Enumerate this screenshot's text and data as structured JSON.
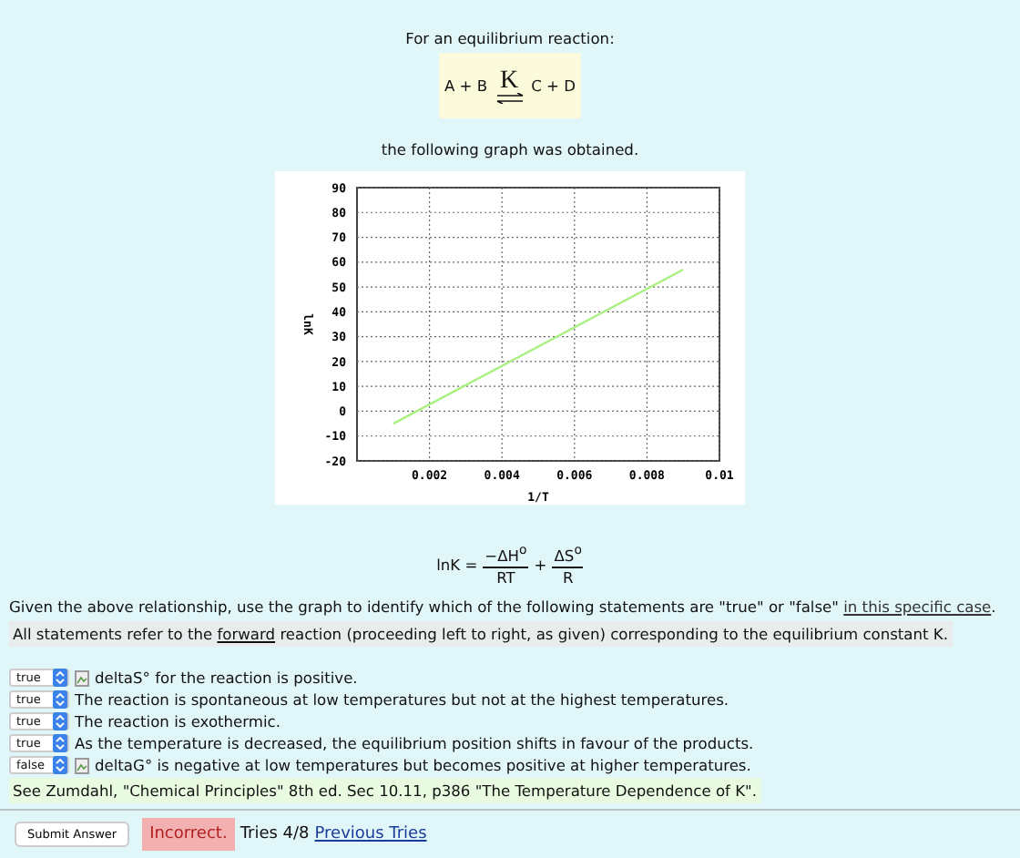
{
  "intro": "For an equilibrium reaction:",
  "reaction": {
    "left": "A + B",
    "constant": "K",
    "right": "C + D"
  },
  "graph_caption": "the following graph was obtained.",
  "chart_data": {
    "type": "line",
    "xlabel": "1/T",
    "ylabel": "lnK",
    "x": [
      0.001,
      0.009
    ],
    "series": [
      {
        "color": "#a8f080",
        "values": [
          -5,
          57
        ]
      }
    ],
    "grid": true,
    "xlim": [
      0,
      0.01
    ],
    "ylim": [
      -20,
      90
    ],
    "xticks": [
      {
        "value": 0.002,
        "label": "0.002"
      },
      {
        "value": 0.004,
        "label": "0.004"
      },
      {
        "value": 0.006,
        "label": "0.006"
      },
      {
        "value": 0.008,
        "label": "0.008"
      },
      {
        "value": 0.01,
        "label": "0.01"
      }
    ],
    "yticks": [
      -20,
      -10,
      0,
      10,
      20,
      30,
      40,
      50,
      60,
      70,
      80,
      90
    ]
  },
  "equation": {
    "lhs": "lnK =",
    "term1_num": "−ΔH$^{o}$",
    "term1_den": "RT",
    "operator": "+",
    "term2_num": "ΔS$^{o}$",
    "term2_den": "R"
  },
  "instruction": {
    "text": "Given the above relationship, use the graph to identify which of the following statements are \"true\" or \"false\"",
    "link": "in this specific case",
    "end": "."
  },
  "note": {
    "before": "All statements refer to the",
    "underlined": "forward",
    "after": "reaction (proceeding left to right, as given) corresponding to the equilibrium constant K."
  },
  "statements": [
    {
      "answer": "true",
      "has_image": true,
      "text": "deltaS° for the reaction is positive."
    },
    {
      "answer": "true",
      "has_image": false,
      "text": "The reaction is spontaneous at low temperatures but not at the highest temperatures."
    },
    {
      "answer": "true",
      "has_image": false,
      "text": "The reaction is exothermic."
    },
    {
      "answer": "true",
      "has_image": false,
      "text": "As the temperature is decreased, the equilibrium position shifts in favour of the products."
    },
    {
      "answer": "false",
      "has_image": true,
      "text": "deltaG° is negative at low temperatures but becomes positive at higher temperatures."
    }
  ],
  "reference": "See Zumdahl, \"Chemical Principles\" 8th ed. Sec 10.11, p386 \"The Temperature Dependence of K\".",
  "submit_button": "Submit Answer",
  "result": {
    "status": "Incorrect.",
    "correct": false
  },
  "tries": "Tries 4/8",
  "previous_tries_link": "Previous Tries"
}
